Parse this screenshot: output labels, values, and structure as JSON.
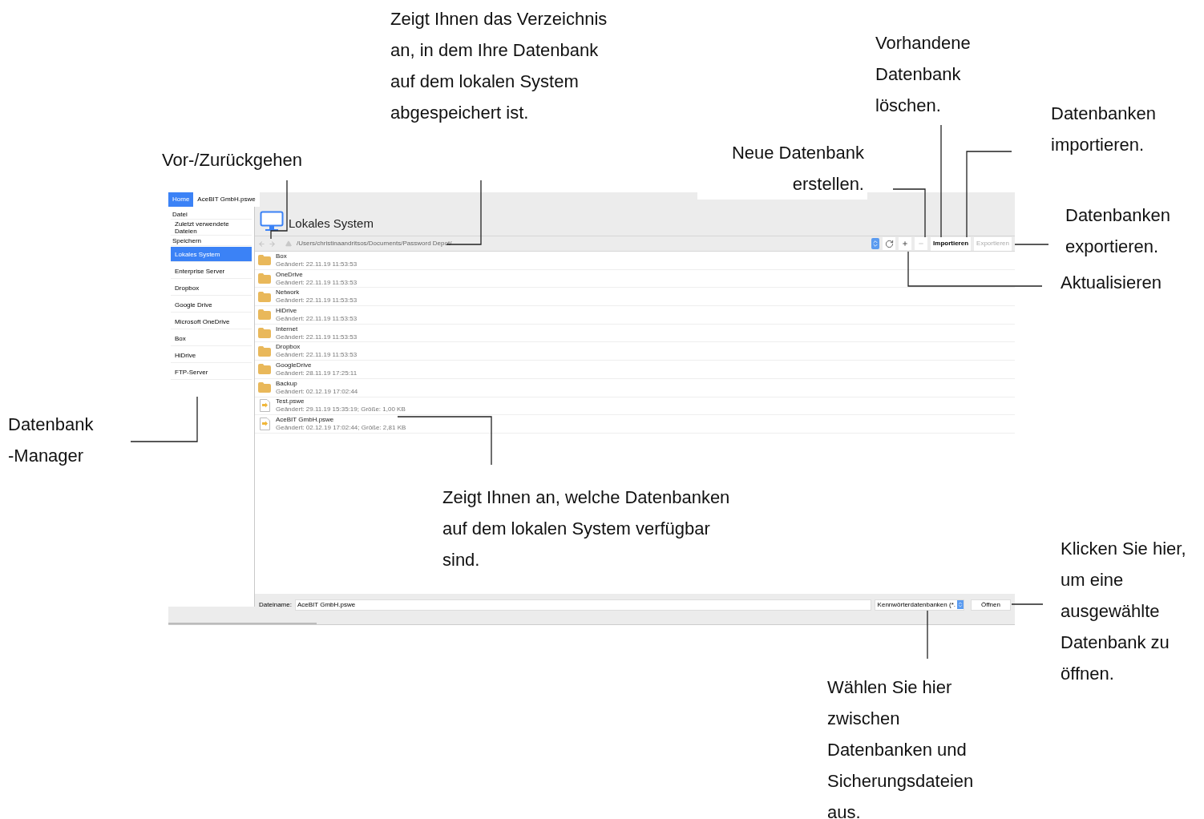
{
  "window": {
    "tabs": [
      {
        "label": "Home",
        "selected": true
      },
      {
        "label": "AceBIT GmbH.pswe",
        "selected": false
      }
    ],
    "sidebar": {
      "sections": [
        {
          "header": "Datei",
          "items": [
            {
              "label": "Zuletzt verwendete Dateien",
              "selected": false
            }
          ]
        },
        {
          "header": "Speichern",
          "items": [
            {
              "label": "Lokales System",
              "selected": true
            },
            {
              "label": "Enterprise Server",
              "selected": false
            },
            {
              "label": "Dropbox",
              "selected": false
            },
            {
              "label": "Google Drive",
              "selected": false
            },
            {
              "label": "Microsoft OneDrive",
              "selected": false
            },
            {
              "label": "Box",
              "selected": false
            },
            {
              "label": "HiDrive",
              "selected": false
            },
            {
              "label": "FTP-Server",
              "selected": false
            }
          ]
        }
      ]
    },
    "location_title": "Lokales System",
    "toolbar": {
      "back_disabled": true,
      "forward_disabled": true,
      "up_disabled": true,
      "path": "/Users/christinaandritsos/Documents/Password Depot/",
      "add_disabled": false,
      "remove_disabled": true,
      "buttons": [
        {
          "label": "Importieren",
          "disabled": false
        },
        {
          "label": "Exportieren",
          "disabled": true
        }
      ]
    },
    "files": [
      {
        "kind": "folder",
        "name": "Box",
        "info": "Geändert: 22.11.19 11:53:53"
      },
      {
        "kind": "folder",
        "name": "OneDrive",
        "info": "Geändert: 22.11.19 11:53:53"
      },
      {
        "kind": "folder",
        "name": "Network",
        "info": "Geändert: 22.11.19 11:53:53"
      },
      {
        "kind": "folder",
        "name": "HiDrive",
        "info": "Geändert: 22.11.19 11:53:53"
      },
      {
        "kind": "folder",
        "name": "Internet",
        "info": "Geändert: 22.11.19 11:53:53"
      },
      {
        "kind": "folder",
        "name": "Dropbox",
        "info": "Geändert: 22.11.19 11:53:53"
      },
      {
        "kind": "folder",
        "name": "GoogleDrive",
        "info": "Geändert: 28.11.19 17:25:11"
      },
      {
        "kind": "folder",
        "name": "Backup",
        "info": "Geändert: 02.12.19 17:02:44"
      },
      {
        "kind": "file",
        "name": "Test.pswe",
        "info": "Geändert: 29.11.19 15:35:19; Größe: 1,00 KB"
      },
      {
        "kind": "file",
        "name": "AceBIT GmbH.pswe",
        "info": "Geändert: 02.12.19 17:02:44; Größe: 2,81 KB"
      }
    ],
    "footer": {
      "filename_label": "Dateiname:",
      "filename": "AceBIT GmbH.pswe",
      "filter": "Kennwörterdatenbanken (*.",
      "open_button": "Öffnen"
    }
  },
  "annotations": [
    "Zeigt Ihnen das Verzeichnis an, in dem Ihre Datenbank auf dem lokalen System abgespeichert ist.",
    "Vorhandene Datenbank löschen.",
    "Datenbanken importieren.",
    "Vor-/Zurückgehen",
    "Neue Datenbank erstellen.",
    "Datenbanken exportieren.",
    "Aktualisieren",
    "Datenbank\n-Manager",
    "Zeigt Ihnen an, welche Datenbanken auf dem lokalen System verfügbar sind.",
    "Klicken Sie hier, um eine ausgewählte Datenbank zu öffnen.",
    "Wählen Sie hier zwischen Datenbanken und Sicherungsdateien aus."
  ]
}
